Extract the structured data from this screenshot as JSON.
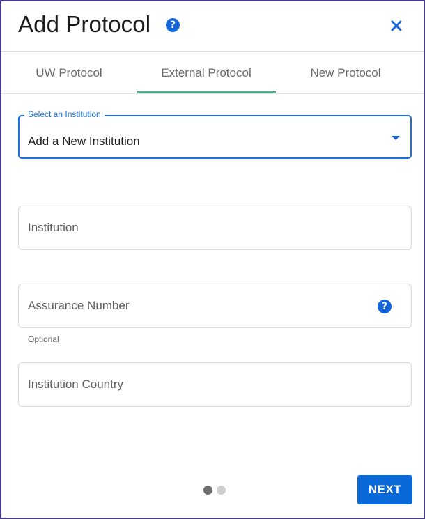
{
  "dialog": {
    "title": "Add Protocol",
    "help_icon": "help-circle-icon",
    "close_icon": "close-icon"
  },
  "tabs": [
    {
      "label": "UW Protocol",
      "active": false
    },
    {
      "label": "External Protocol",
      "active": true
    },
    {
      "label": "New Protocol",
      "active": false
    }
  ],
  "institution_select": {
    "label": "Select an Institution",
    "value": "Add a New Institution",
    "icon": "caret-down-icon"
  },
  "fields": {
    "institution": {
      "placeholder": "Institution",
      "value": ""
    },
    "assurance_number": {
      "placeholder": "Assurance Number",
      "value": "",
      "hint": "Optional",
      "help_icon": "help-circle-icon"
    },
    "institution_country": {
      "placeholder": "Institution Country",
      "value": ""
    }
  },
  "stepper": {
    "total_steps": 2,
    "current_step": 1
  },
  "footer": {
    "next_label": "NEXT"
  },
  "colors": {
    "accent": "#1565d8",
    "tab_indicator": "#4caf83",
    "dialog_border": "#4a3b86",
    "button": "#0a69d8"
  }
}
